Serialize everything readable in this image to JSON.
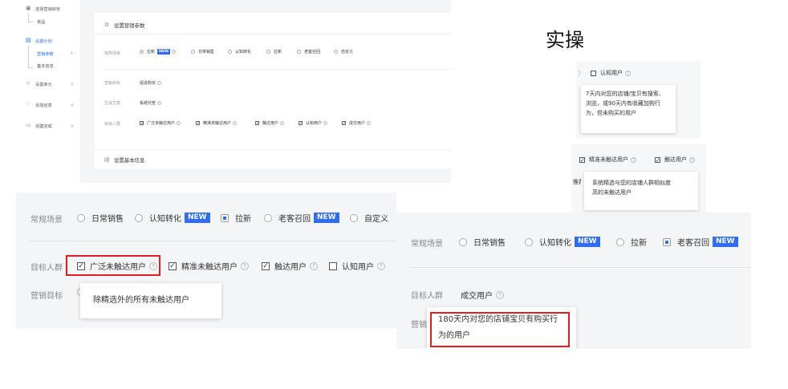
{
  "overlay_title": "实操",
  "setup_screen": {
    "sidebar": {
      "step1": "选择营销目标",
      "step1_sub": "单品",
      "step2": "设置计划",
      "step2_sub1": "营销参数",
      "step2_sub2": "基本信息",
      "step3": "设置单元",
      "step4": "添加创意",
      "step5": "创建完成"
    },
    "section1_title": "设置营销参数",
    "section2_title": "设置基本信息",
    "scene_label": "常规场景",
    "scene_options": [
      "拉新",
      "日常销售",
      "认知转化",
      "拉新",
      "老客召回",
      "自定义"
    ],
    "new_badge": "NEW",
    "goal_label": "营销目标",
    "goal_value": "促进购买",
    "plan_label": "生成方案",
    "plan_value": "系统托管",
    "audience_label": "目标人群",
    "audience_options": [
      "广泛未触达用户",
      "精准未触达用户",
      "触达用户",
      "认知用户",
      "成交用户"
    ]
  },
  "tooltip_cognitive": {
    "option": "认知用户",
    "text": [
      "7天内对您的店铺/宝贝有搜索、",
      "浏览，或90天内有收藏加购行",
      "为，但未购买的用户"
    ]
  },
  "tooltip_precise": {
    "option1": "精准未触达用户",
    "option2": "触达用户",
    "side_text": "推荐",
    "text": [
      "系统精选与您的店铺人群相似度",
      "高的未触达用户"
    ]
  },
  "crop_broad": {
    "scene_label": "常规场景",
    "scene_options": [
      "日常销售",
      "认知转化",
      "拉新",
      "老客召回",
      "自定义"
    ],
    "new_badge": "NEW",
    "audience_label": "目标人群",
    "audience_options": [
      "广泛未触达用户",
      "精准未触达用户",
      "触达用户",
      "认知用户"
    ],
    "goal_label": "营销目标",
    "tooltip_text": "除精选外的所有未触达用户"
  },
  "crop_retention": {
    "scene_label": "常规场景",
    "scene_options": [
      "日常销售",
      "认知转化",
      "拉新",
      "老客召回"
    ],
    "new_badge": "NEW",
    "audience_label": "目标人群",
    "audience_value": "成交用户",
    "goal_label_partial": "营销",
    "tooltip_text": [
      "180天内对您的店铺宝贝有购买行",
      "为的用户"
    ]
  },
  "colors": {
    "accent": "#2f6df5",
    "highlight": "#e02020"
  }
}
